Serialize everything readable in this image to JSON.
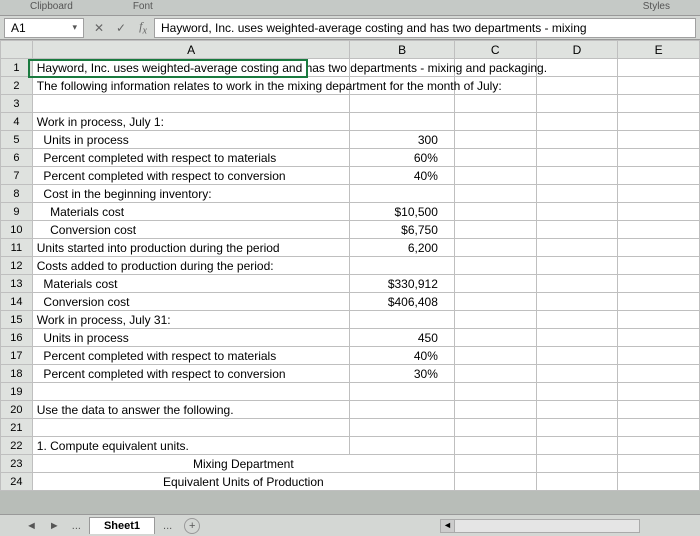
{
  "topstrip": {
    "left": "Clipboard",
    "mid": "Font",
    "right": "Styles"
  },
  "nameBox": "A1",
  "formula": "Hayword, Inc. uses weighted-average costing and has two departments - mixing",
  "columns": [
    "",
    "A",
    "B",
    "C",
    "D",
    "E"
  ],
  "rows": [
    {
      "n": 1,
      "a": "Hayword, Inc. uses weighted-average costing and has two departments - mixing and packaging.",
      "b": ""
    },
    {
      "n": 2,
      "a": "The following information relates to work in the mixing department for the month of July:",
      "b": ""
    },
    {
      "n": 3,
      "a": "",
      "b": ""
    },
    {
      "n": 4,
      "a": "Work in process, July 1:",
      "b": ""
    },
    {
      "n": 5,
      "a": "  Units in process",
      "b": "300"
    },
    {
      "n": 6,
      "a": "  Percent completed with respect to materials",
      "b": "60%"
    },
    {
      "n": 7,
      "a": "  Percent completed with respect to conversion",
      "b": "40%"
    },
    {
      "n": 8,
      "a": "  Cost in the beginning inventory:",
      "b": ""
    },
    {
      "n": 9,
      "a": "    Materials cost",
      "b": "$10,500"
    },
    {
      "n": 10,
      "a": "    Conversion cost",
      "b": "$6,750"
    },
    {
      "n": 11,
      "a": "Units started into production during the period",
      "b": "6,200"
    },
    {
      "n": 12,
      "a": "Costs added to production during the period:",
      "b": ""
    },
    {
      "n": 13,
      "a": "  Materials cost",
      "b": "$330,912"
    },
    {
      "n": 14,
      "a": "  Conversion cost",
      "b": "$406,408"
    },
    {
      "n": 15,
      "a": "Work in process, July 31:",
      "b": ""
    },
    {
      "n": 16,
      "a": "  Units in process",
      "b": "450"
    },
    {
      "n": 17,
      "a": "  Percent completed with respect to materials",
      "b": "40%"
    },
    {
      "n": 18,
      "a": "  Percent completed with respect to conversion",
      "b": "30%"
    },
    {
      "n": 19,
      "a": "",
      "b": ""
    },
    {
      "n": 20,
      "a": "Use the data to answer the following.",
      "b": ""
    },
    {
      "n": 21,
      "a": "",
      "b": ""
    },
    {
      "n": 22,
      "a": "1. Compute equivalent units.",
      "b": ""
    },
    {
      "n": 23,
      "a": "Mixing Department",
      "b": "",
      "center": true
    },
    {
      "n": 24,
      "a": "Equivalent Units of Production",
      "b": "",
      "center": true
    }
  ],
  "sheetTab": "Sheet1",
  "ellipsis": "...",
  "plus": "+"
}
